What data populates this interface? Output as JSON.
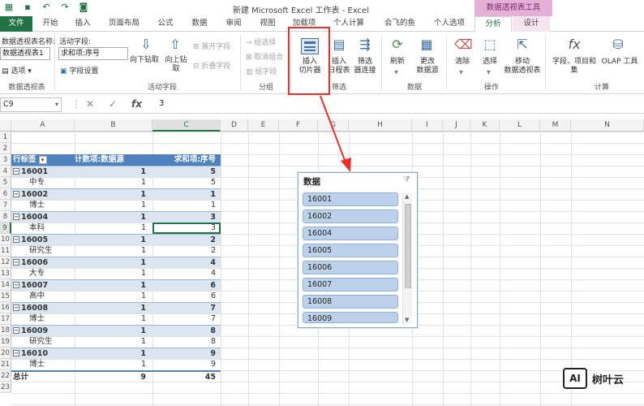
{
  "window": {
    "title": "新建 Microsoft Excel 工作表 - Excel",
    "context_tab_group": "数据透视表工具"
  },
  "tabs": [
    {
      "label": "文件"
    },
    {
      "label": "开始"
    },
    {
      "label": "插入"
    },
    {
      "label": "页面布局"
    },
    {
      "label": "公式"
    },
    {
      "label": "数据"
    },
    {
      "label": "审阅"
    },
    {
      "label": "视图"
    },
    {
      "label": "加载项"
    },
    {
      "label": "个人计算"
    },
    {
      "label": "会飞的鱼"
    },
    {
      "label": "个人选项"
    },
    {
      "label": "分析"
    },
    {
      "label": "设计"
    }
  ],
  "ribbon": {
    "pivot_name_label": "数据透视表名称:",
    "pivot_name_value": "数据透视表1",
    "options_label": "选项",
    "group_pivot": "数据透视表",
    "active_field_label": "活动字段:",
    "active_field_value": "求和项:序号",
    "field_settings": "字段设置",
    "drill_down": "向下钻取",
    "drill_up": "向上钻\n取",
    "expand_field": "展开字段",
    "collapse_field": "折叠字段",
    "group_active_field": "活动字段",
    "group_selection": "组选择",
    "ungroup": "取消组合",
    "group_field": "组字段",
    "group_group": "分组",
    "insert_slicer": "插入\n切片器",
    "insert_timeline": "插入\n日程表",
    "filter_connections": "筛选\n器连接",
    "group_filter": "筛选",
    "refresh": "刷新",
    "change_source": "更改\n数据源",
    "group_data": "数据",
    "clear": "清除",
    "select": "选择",
    "move_pivot": "移动\n数据透视表",
    "group_actions": "操作",
    "fields_items_sets": "字段、项目和\n集",
    "olap_tools": "OLAP 工具",
    "group_calc": "计算"
  },
  "formula_bar": {
    "name_box": "C9",
    "value": "3"
  },
  "columns": [
    "A",
    "B",
    "C",
    "D",
    "E",
    "F",
    "G",
    "H",
    "I",
    "J",
    "K",
    "L",
    "M",
    "N"
  ],
  "rows": [
    "1",
    "2",
    "3",
    "4",
    "5",
    "6",
    "7",
    "8",
    "9",
    "10",
    "11",
    "12",
    "13",
    "14",
    "15",
    "16",
    "17",
    "18",
    "19",
    "20",
    "21",
    "22",
    "23"
  ],
  "pivot": {
    "header": [
      "行标签",
      "计数项:数据源",
      "求和项:序号"
    ],
    "records": [
      {
        "a": "16001",
        "b": "1",
        "c": "5",
        "level": 1
      },
      {
        "a": "中专",
        "b": "1",
        "c": "5",
        "level": 2
      },
      {
        "a": "16002",
        "b": "1",
        "c": "1",
        "level": 1
      },
      {
        "a": "博士",
        "b": "1",
        "c": "1",
        "level": 2
      },
      {
        "a": "16004",
        "b": "1",
        "c": "3",
        "level": 1
      },
      {
        "a": "本科",
        "b": "1",
        "c": "3",
        "level": 2
      },
      {
        "a": "16005",
        "b": "1",
        "c": "2",
        "level": 1
      },
      {
        "a": "研究生",
        "b": "1",
        "c": "2",
        "level": 2
      },
      {
        "a": "16006",
        "b": "1",
        "c": "4",
        "level": 1
      },
      {
        "a": "大专",
        "b": "1",
        "c": "4",
        "level": 2
      },
      {
        "a": "16007",
        "b": "1",
        "c": "6",
        "level": 1
      },
      {
        "a": "高中",
        "b": "1",
        "c": "6",
        "level": 2
      },
      {
        "a": "16008",
        "b": "1",
        "c": "7",
        "level": 1
      },
      {
        "a": "博士",
        "b": "1",
        "c": "7",
        "level": 2
      },
      {
        "a": "16009",
        "b": "1",
        "c": "8",
        "level": 1
      },
      {
        "a": "研究生",
        "b": "1",
        "c": "8",
        "level": 2
      },
      {
        "a": "16010",
        "b": "1",
        "c": "9",
        "level": 1
      },
      {
        "a": "博士",
        "b": "1",
        "c": "9",
        "level": 2
      }
    ],
    "total": {
      "a": "总计",
      "b": "9",
      "c": "45"
    }
  },
  "slicer": {
    "title": "数据",
    "items": [
      "16001",
      "16002",
      "16004",
      "16005",
      "16006",
      "16007",
      "16008",
      "16009"
    ]
  },
  "watermark": {
    "logo": "AI",
    "text": "树叶云"
  },
  "colors": {
    "excel_green": "#217346",
    "pivot_header": "#4f81bd",
    "pivot_band": "#dce6f1",
    "highlight": "#e8302a",
    "slicer_item": "#bdd2ea"
  }
}
